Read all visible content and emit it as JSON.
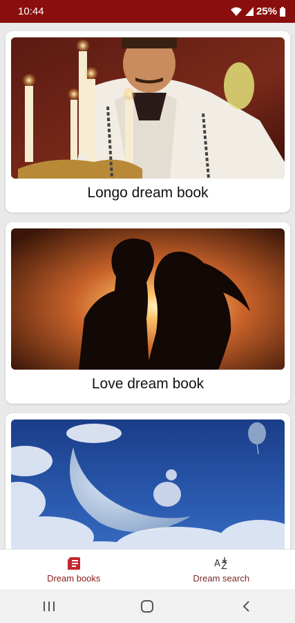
{
  "status_bar": {
    "time": "10:44",
    "battery": "25%",
    "icons": [
      "wifi-icon",
      "signal-icon",
      "battery-icon"
    ]
  },
  "cards": [
    {
      "title": "Longo dream book",
      "image": "magician-with-candles-image"
    },
    {
      "title": "Love dream book",
      "image": "couple-silhouette-sunset-image"
    },
    {
      "title": "",
      "image": "moon-clouds-night-image"
    }
  ],
  "bottom_nav": {
    "items": [
      {
        "label": "Dream books",
        "icon": "book-icon",
        "active": true
      },
      {
        "label": "Dream search",
        "icon": "az-sort-icon",
        "active": false
      }
    ]
  },
  "system_nav": [
    "recent-apps-icon",
    "home-icon",
    "back-icon"
  ],
  "colors": {
    "status_bar": "#8b0e0e",
    "accent": "#c0282d",
    "background": "#e9e9e9"
  }
}
